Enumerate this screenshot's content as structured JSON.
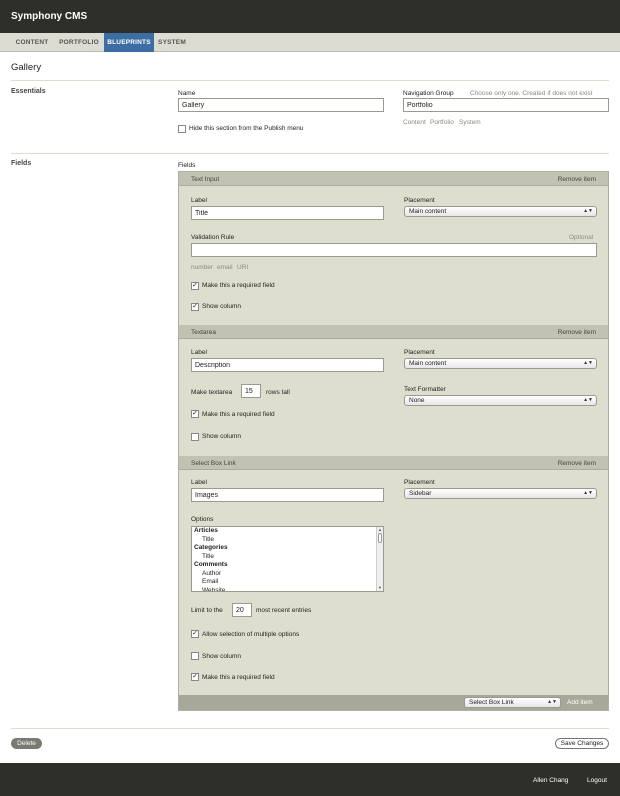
{
  "app": {
    "title": "Symphony CMS"
  },
  "nav": {
    "tabs": [
      "CONTENT",
      "PORTFOLIO",
      "BLUEPRINTS",
      "SYSTEM"
    ],
    "active": "BLUEPRINTS"
  },
  "page": {
    "title": "Gallery"
  },
  "essentials": {
    "section_label": "Essentials",
    "name_label": "Name",
    "name_value": "Gallery",
    "nav_group_label": "Navigation Group",
    "nav_group_hint": "Choose only one. Created if does not exist",
    "nav_group_value": "Portfolio",
    "nav_group_options": [
      "Content",
      "Portfolio",
      "System"
    ],
    "hide_section_label": "Hide this section from the Publish menu",
    "hide_section_checked": false
  },
  "fields": {
    "section_label": "Fields",
    "list_label": "Fields",
    "remove_label": "Remove item",
    "items": [
      {
        "type": "Text Input",
        "label_label": "Label",
        "label_value": "Title",
        "placement_label": "Placement",
        "placement_value": "Main content",
        "validation_label": "Validation Rule",
        "validation_optional": "Optional",
        "validation_value": "",
        "validation_options": [
          "number",
          "email",
          "URI"
        ],
        "required_label": "Make this a required field",
        "required_checked": true,
        "show_column_label": "Show column",
        "show_column_checked": true
      },
      {
        "type": "Textarea",
        "label_label": "Label",
        "label_value": "Description",
        "placement_label": "Placement",
        "placement_value": "Main content",
        "rows_prefix": "Make textarea",
        "rows_value": "15",
        "rows_suffix": "rows tall",
        "formatter_label": "Text Formatter",
        "formatter_value": "None",
        "required_label": "Make this a required field",
        "required_checked": true,
        "show_column_label": "Show column",
        "show_column_checked": false
      },
      {
        "type": "Select Box Link",
        "label_label": "Label",
        "label_value": "Images",
        "placement_label": "Placement",
        "placement_value": "Sidebar",
        "options_label": "Options",
        "options": [
          {
            "text": "Articles",
            "group": true
          },
          {
            "text": "Title",
            "group": false
          },
          {
            "text": "Categories",
            "group": true
          },
          {
            "text": "Title",
            "group": false
          },
          {
            "text": "Comments",
            "group": true
          },
          {
            "text": "Author",
            "group": false
          },
          {
            "text": "Email",
            "group": false
          },
          {
            "text": "Website",
            "group": false
          }
        ],
        "limit_prefix": "Limit to the",
        "limit_value": "20",
        "limit_suffix": "most recent entries",
        "multiple_label": "Allow selection of multiple options",
        "multiple_checked": true,
        "show_column_label": "Show column",
        "show_column_checked": false,
        "required_label": "Make this a required field",
        "required_checked": true
      }
    ],
    "add_type_value": "Select Box Link",
    "add_label": "Add item"
  },
  "actions": {
    "delete_label": "Delete",
    "save_label": "Save Changes"
  },
  "footer": {
    "user": "Allen Chang",
    "logout": "Logout"
  },
  "colors": {
    "header_bg": "#2e2e2b",
    "active_tab": "#3d6ea3",
    "panel_bg": "#dedecf",
    "panel_header": "#c2c2b2"
  }
}
